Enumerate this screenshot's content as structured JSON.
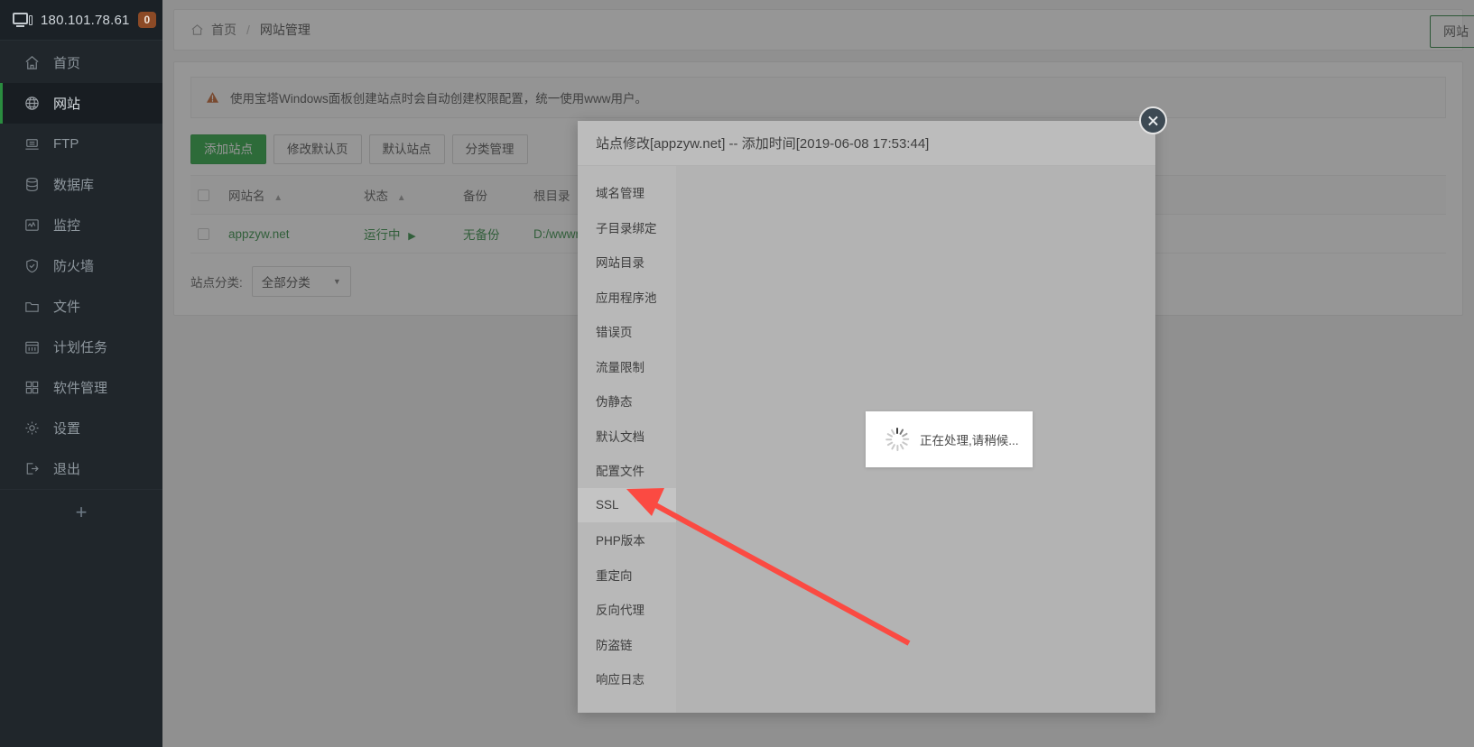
{
  "sidebar": {
    "ip": "180.101.78.61",
    "badge": "0",
    "items": [
      {
        "label": "首页",
        "icon": "home-icon"
      },
      {
        "label": "网站",
        "icon": "globe-icon"
      },
      {
        "label": "FTP",
        "icon": "ftp-icon"
      },
      {
        "label": "数据库",
        "icon": "database-icon"
      },
      {
        "label": "监控",
        "icon": "monitor-chart-icon"
      },
      {
        "label": "防火墙",
        "icon": "shield-icon"
      },
      {
        "label": "文件",
        "icon": "folder-icon"
      },
      {
        "label": "计划任务",
        "icon": "calendar-icon"
      },
      {
        "label": "软件管理",
        "icon": "grid-icon"
      },
      {
        "label": "设置",
        "icon": "gear-icon"
      },
      {
        "label": "退出",
        "icon": "logout-icon"
      }
    ],
    "add_label": "+"
  },
  "breadcrumb": {
    "home": "首页",
    "separator": "/",
    "current": "网站管理"
  },
  "topright": {
    "label": "网站"
  },
  "notice": {
    "text": "使用宝塔Windows面板创建站点时会自动创建权限配置，统一使用www用户。"
  },
  "toolbar": {
    "add_site": "添加站点",
    "edit_default_page": "修改默认页",
    "default_site": "默认站点",
    "category_manage": "分类管理"
  },
  "table": {
    "headers": [
      "",
      "网站名",
      "状态",
      "备份",
      "根目录"
    ],
    "rows": [
      {
        "name": "appzyw.net",
        "status": "运行中",
        "backup": "无备份",
        "root": "D:/wwwroot/ap"
      }
    ]
  },
  "filter": {
    "label": "站点分类:",
    "selected": "全部分类",
    "options": [
      "全部分类"
    ]
  },
  "modal": {
    "title": "站点修改[appzyw.net] -- 添加时间[2019-06-08 17:53:44]",
    "nav": [
      {
        "label": "域名管理",
        "active": false
      },
      {
        "label": "子目录绑定",
        "active": false
      },
      {
        "label": "网站目录",
        "active": false
      },
      {
        "label": "应用程序池",
        "active": false
      },
      {
        "label": "错误页",
        "active": false
      },
      {
        "label": "流量限制",
        "active": false
      },
      {
        "label": "伪静态",
        "active": false
      },
      {
        "label": "默认文档",
        "active": false
      },
      {
        "label": "配置文件",
        "active": false
      },
      {
        "label": "SSL",
        "active": true
      },
      {
        "label": "PHP版本",
        "active": false
      },
      {
        "label": "重定向",
        "active": false
      },
      {
        "label": "反向代理",
        "active": false
      },
      {
        "label": "防盗链",
        "active": false
      },
      {
        "label": "响应日志",
        "active": false
      }
    ],
    "loading_text": "正在处理,请稍候...",
    "close_label": "×"
  },
  "colors": {
    "sidebar_bg": "#20262b",
    "accent_green": "#20a53a",
    "active_indicator": "#2a8c3f",
    "badge_bg": "#8c4a26",
    "modal_bg": "#b3b3b3",
    "modal_header_bg": "#bcbcbc",
    "modal_nav_bg": "#b8b8b8",
    "modal_nav_active_bg": "#c4c4c4",
    "overlay": "rgba(56,56,56,0.53)",
    "annotation_arrow": "#fb4a42",
    "close_btn_bg": "#3d4a54"
  }
}
